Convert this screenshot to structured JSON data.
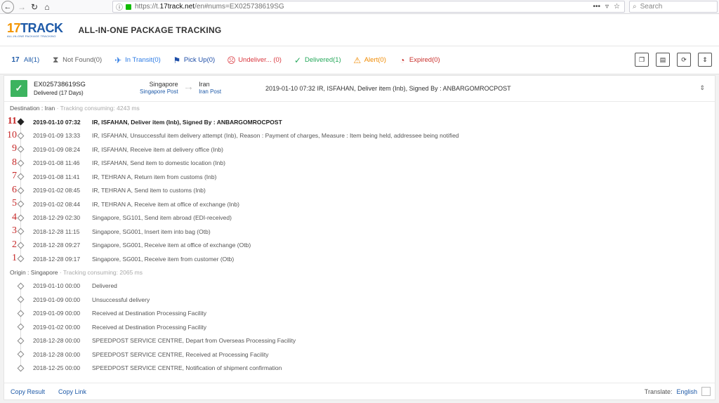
{
  "browser": {
    "url_prefix": "https://t.",
    "url_domain": "17track.net",
    "url_suffix": "/en#nums=EX025738619SG",
    "search_placeholder": "Search",
    "dots": "•••"
  },
  "header": {
    "logo_main_a": "17",
    "logo_main_b": "TRACK",
    "logo_sub": "ALL-IN-ONE PACKAGE TRACKING",
    "title": "ALL-IN-ONE PACKAGE TRACKING"
  },
  "tabs": [
    {
      "label": "All(1)",
      "icon": "17-logo-icon"
    },
    {
      "label": "Not Found(0)",
      "icon": "hourglass-icon"
    },
    {
      "label": "In Transit(0)",
      "icon": "plane-icon"
    },
    {
      "label": "Pick Up(0)",
      "icon": "flag-icon"
    },
    {
      "label": "Undeliver... (0)",
      "icon": "sad-face-icon"
    },
    {
      "label": "Delivered(1)",
      "icon": "check-icon"
    },
    {
      "label": "Alert(0)",
      "icon": "warning-icon"
    },
    {
      "label": "Expired(0)",
      "icon": "clock-history-icon"
    }
  ],
  "package": {
    "number": "EX025738619SG",
    "status": "Delivered (17 Days)",
    "from_country": "Singapore",
    "from_carrier": "Singapore Post",
    "to_country": "Iran",
    "to_carrier": "Iran Post",
    "latest_event": "2019-01-10 07:32  IR, ISFAHAN, Deliver item (Inb), Signed By : ANBARGOMROCPOST"
  },
  "destination_section": {
    "label": "Destination : Iran",
    "consuming": " · Tracking consuming: 4243 ms",
    "events": [
      {
        "n": "11",
        "time": "2019-01-10 07:32",
        "desc": "IR, ISFAHAN, Deliver item (Inb), Signed By : ANBARGOMROCPOST"
      },
      {
        "n": "10",
        "time": "2019-01-09 13:33",
        "desc": "IR, ISFAHAN, Unsuccessful item delivery attempt (Inb), Reason : Payment of charges, Measure : Item being held, addressee being notified"
      },
      {
        "n": "9",
        "time": "2019-01-09 08:24",
        "desc": "IR, ISFAHAN, Receive item at delivery office (Inb)"
      },
      {
        "n": "8",
        "time": "2019-01-08 11:46",
        "desc": "IR, ISFAHAN, Send item to domestic location (Inb)"
      },
      {
        "n": "7",
        "time": "2019-01-08 11:41",
        "desc": "IR, TEHRAN A, Return item from customs (Inb)"
      },
      {
        "n": "6",
        "time": "2019-01-02 08:45",
        "desc": "IR, TEHRAN A, Send item to customs (Inb)"
      },
      {
        "n": "5",
        "time": "2019-01-02 08:44",
        "desc": "IR, TEHRAN A, Receive item at office of exchange (Inb)"
      },
      {
        "n": "4",
        "time": "2018-12-29 02:30",
        "desc": "Singapore, SG101, Send item abroad (EDI-received)"
      },
      {
        "n": "3",
        "time": "2018-12-28 11:15",
        "desc": "Singapore, SG001, Insert item into bag (Otb)"
      },
      {
        "n": "2",
        "time": "2018-12-28 09:27",
        "desc": "Singapore, SG001, Receive item at office of exchange (Otb)"
      },
      {
        "n": "1",
        "time": "2018-12-28 09:17",
        "desc": "Singapore, SG001, Receive item from customer (Otb)"
      }
    ]
  },
  "origin_section": {
    "label": "Origin : Singapore",
    "consuming": " · Tracking consuming: 2065 ms",
    "events": [
      {
        "time": "2019-01-10 00:00",
        "desc": "Delivered"
      },
      {
        "time": "2019-01-09 00:00",
        "desc": "Unsuccessful delivery"
      },
      {
        "time": "2019-01-09 00:00",
        "desc": "Received at Destination Processing Facility"
      },
      {
        "time": "2019-01-02 00:00",
        "desc": "Received at Destination Processing Facility"
      },
      {
        "time": "2018-12-28 00:00",
        "desc": "SPEEDPOST SERVICE CENTRE, Depart from Overseas Processing Facility"
      },
      {
        "time": "2018-12-28 00:00",
        "desc": "SPEEDPOST SERVICE CENTRE, Received at Processing Facility"
      },
      {
        "time": "2018-12-25 00:00",
        "desc": "SPEEDPOST SERVICE CENTRE, Notification of shipment confirmation"
      }
    ]
  },
  "footer": {
    "copy_result": "Copy Result",
    "copy_link": "Copy Link",
    "translate_label": "Translate:",
    "language": "English"
  }
}
